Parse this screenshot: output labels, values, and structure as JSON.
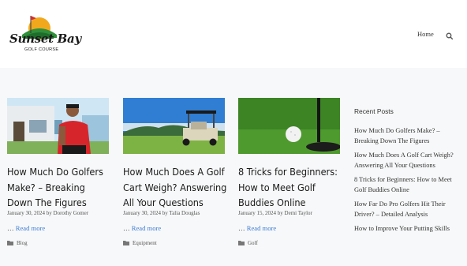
{
  "header": {
    "logo_title": "Sunset Bay",
    "logo_subtitle": "GOLF COURSE",
    "nav_home": "Home",
    "search_icon": "search-icon"
  },
  "posts": [
    {
      "title": "How Much Do Golfers Make? – Breaking Down The Figures",
      "date": "January 30, 2024",
      "by": "by",
      "author": "Dorothy Gomer",
      "ellipsis": "…",
      "read_more": "Read more",
      "category": "Blog"
    },
    {
      "title": "How Much Does A Golf Cart Weigh? Answering All Your Questions",
      "date": "January 30, 2024",
      "by": "by",
      "author": "Talia Douglas",
      "ellipsis": "…",
      "read_more": "Read more",
      "category": "Equipment"
    },
    {
      "title": "8 Tricks for Beginners: How to Meet Golf Buddies Online",
      "date": "January 15, 2024",
      "by": "by",
      "author": "Demi Taylor",
      "ellipsis": "…",
      "read_more": "Read more",
      "category": "Golf"
    }
  ],
  "sidebar": {
    "title": "Recent Posts",
    "items": [
      "How Much Do Golfers Make? – Breaking Down The Figures",
      "How Much Does A Golf Cart Weigh? Answering All Your Questions",
      "8 Tricks for Beginners: How to Meet Golf Buddies Online",
      "How Far Do Pro Golfers Hit Their Driver? – Detailed Analysis",
      "How to Improve Your Putting Skills"
    ]
  },
  "colors": {
    "link": "#3a7bd5",
    "header_bg": "#ffffff",
    "page_bg": "#f7f8f9"
  }
}
